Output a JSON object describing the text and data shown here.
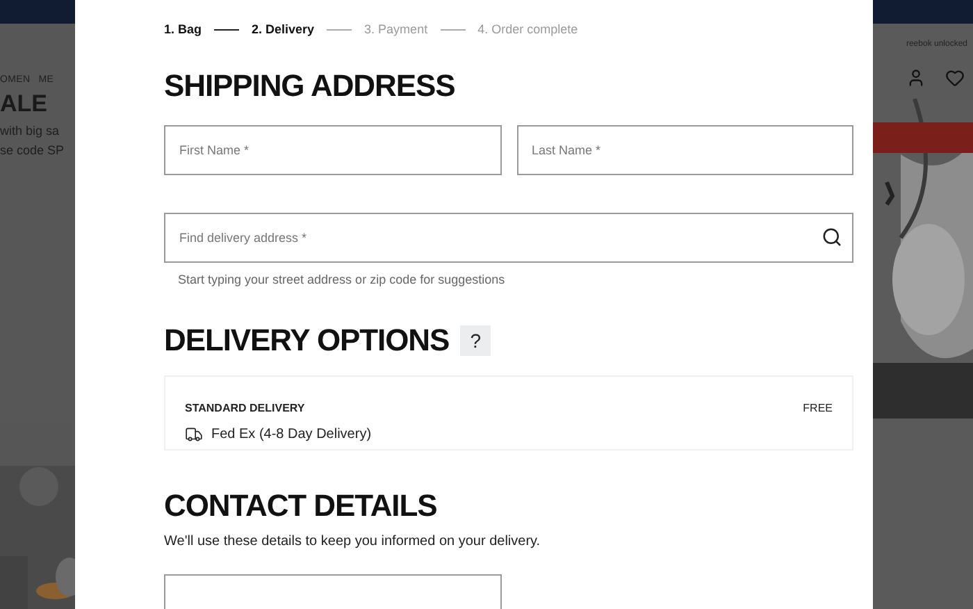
{
  "background_left": {
    "nav_item": "OMEN",
    "nav_item_2": "ME",
    "headline": "ALE",
    "lines": [
      "with big sa",
      "se code SP"
    ]
  },
  "background_right": {
    "promo_link": "reebok unlocked"
  },
  "steps": [
    {
      "label": "1. Bag",
      "active": true
    },
    {
      "label": "2. Delivery",
      "active": true
    },
    {
      "label": "3. Payment",
      "active": false
    },
    {
      "label": "4. Order complete",
      "active": false
    }
  ],
  "shipping": {
    "title": "SHIPPING ADDRESS",
    "first_name": {
      "placeholder": "First Name *"
    },
    "last_name": {
      "placeholder": "Last Name *"
    },
    "address": {
      "placeholder": "Find delivery address *",
      "hint": "Start typing your street address or zip code for suggestions"
    }
  },
  "delivery": {
    "title": "DELIVERY OPTIONS",
    "help": "?",
    "options": [
      {
        "name": "STANDARD DELIVERY",
        "carrier": "Fed Ex (4-8 Day Delivery)",
        "price": "FREE"
      }
    ]
  },
  "contact": {
    "title": "CONTACT DETAILS",
    "note": "We'll use these details to keep you informed on your delivery."
  }
}
